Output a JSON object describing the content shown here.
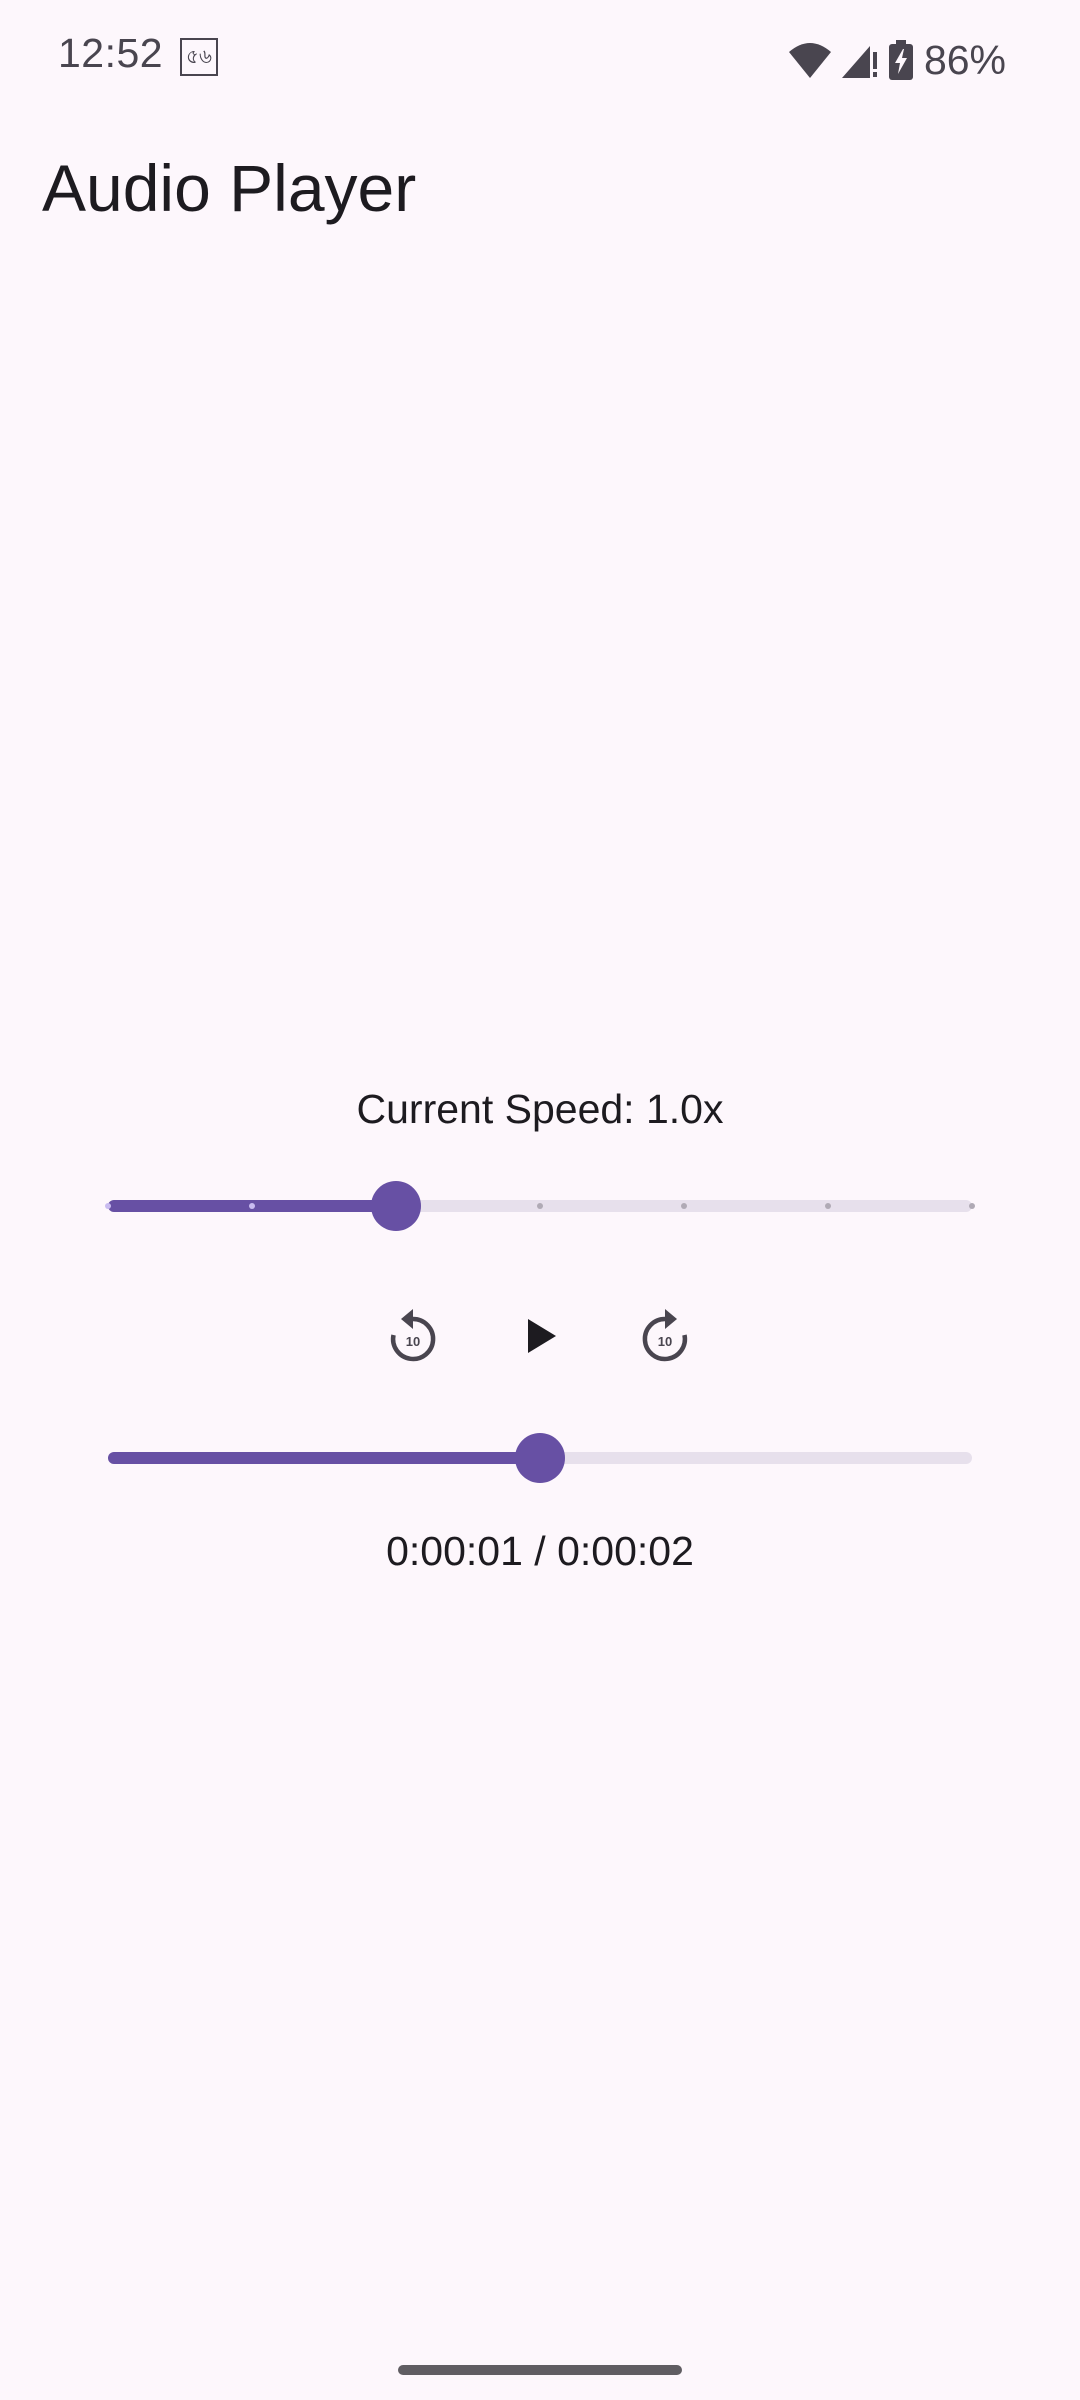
{
  "status_bar": {
    "time": "12:52",
    "notification_glyph": "৫৬",
    "battery_percent": "86%",
    "icons": [
      "wifi-icon",
      "cell-signal-icon",
      "battery-charging-icon"
    ]
  },
  "app": {
    "title": "Audio Player"
  },
  "speed": {
    "label": "Current Speed: 1.0x",
    "slider_fraction": 0.3333,
    "tick_count": 7
  },
  "controls": {
    "rewind_seconds": "10",
    "forward_seconds": "10",
    "rewind_icon": "replay-10-icon",
    "play_icon": "play-icon",
    "forward_icon": "forward-10-icon"
  },
  "progress": {
    "fraction": 0.5,
    "time_label": "0:00:01 / 0:00:02"
  },
  "colors": {
    "background": "#fdf7fc",
    "accent": "#6750a4",
    "inactive_track": "#e7e0ec",
    "text": "#1d1b20",
    "icon": "#49454f"
  }
}
